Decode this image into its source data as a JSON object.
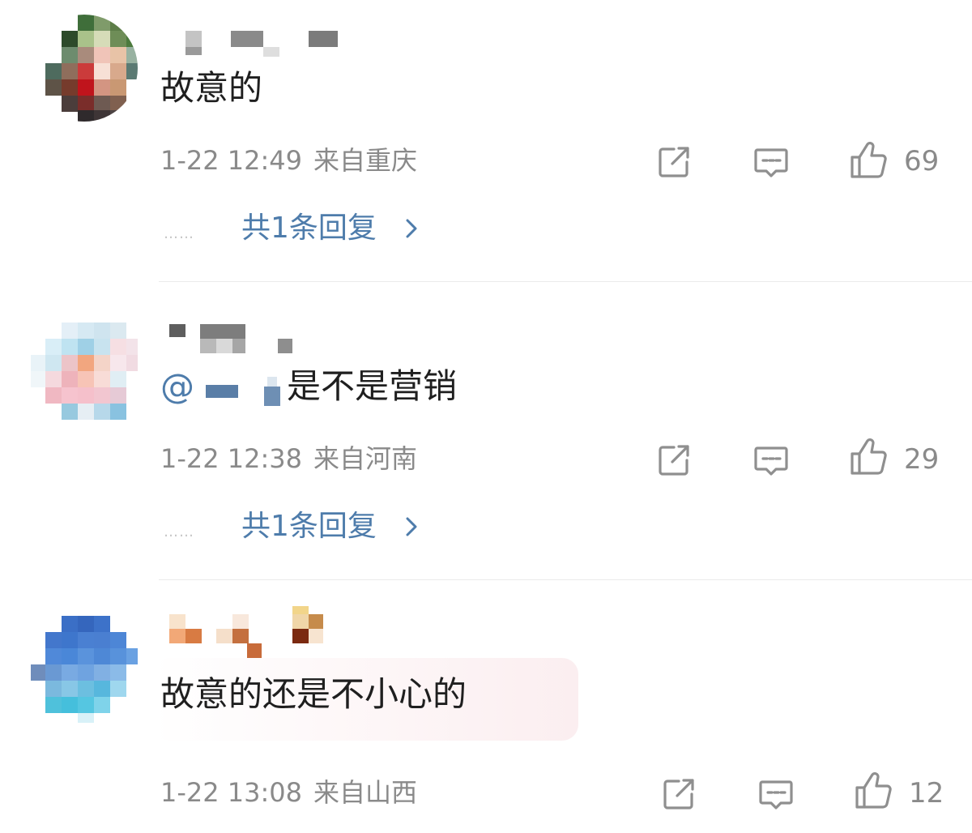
{
  "comments": [
    {
      "text": "故意的",
      "time": "1-22 12:49",
      "location": "来自重庆",
      "likes": "69",
      "replies_label": "共1条回复",
      "replies_dots": "……"
    },
    {
      "mention_symbol": "@",
      "text": "是不是营销",
      "time": "1-22 12:38",
      "location": "来自河南",
      "likes": "29",
      "replies_label": "共1条回复",
      "replies_dots": "……"
    },
    {
      "text": "故意的还是不小心的",
      "time": "1-22 13:08",
      "location": "来自山西",
      "likes": "12"
    }
  ],
  "colors": {
    "link": "#4e7cab",
    "meta": "#8a8a8a",
    "text": "#1f1f1f",
    "divider": "#ebebeb",
    "icon": "#8f8f8f"
  },
  "icons": [
    "share-icon",
    "comment-icon",
    "like-icon",
    "chevron-right-icon"
  ]
}
